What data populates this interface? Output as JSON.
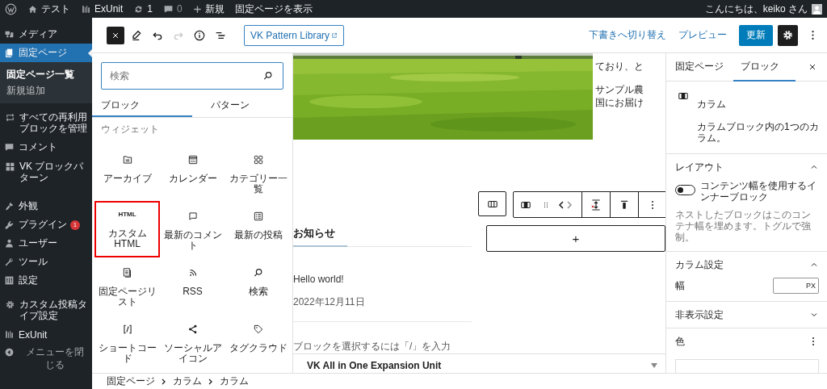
{
  "admin_bar": {
    "items": [
      {
        "kind": "wp"
      },
      {
        "kind": "site",
        "label": "テスト"
      },
      {
        "kind": "exunit",
        "label": "ExUnit"
      },
      {
        "kind": "updates",
        "label": "1"
      },
      {
        "kind": "comments",
        "label": "0"
      },
      {
        "kind": "new",
        "label": "新規"
      },
      {
        "kind": "view",
        "label": "固定ページを表示"
      }
    ],
    "greeting": "こんにちは、keiko さん"
  },
  "sidebar": {
    "sections": [
      {
        "items": [
          {
            "kind": "media",
            "label": "メディア",
            "selected": false
          },
          {
            "kind": "pages",
            "label": "固定ページ",
            "selected": true,
            "children": [
              {
                "label": "固定ページ一覧",
                "selected": true
              },
              {
                "label": "新規追加",
                "selected": false
              }
            ]
          }
        ]
      },
      {
        "items": [
          {
            "kind": "reuse",
            "label": "すべての再利用ブロックを管理",
            "selected": false
          },
          {
            "kind": "comments",
            "label": "コメント",
            "selected": false
          },
          {
            "kind": "grid",
            "label": "VK ブロックパターン",
            "selected": false
          }
        ]
      },
      {
        "items": [
          {
            "kind": "appearance",
            "label": "外観",
            "selected": false
          },
          {
            "kind": "plugins",
            "label": "プラグイン",
            "badge": "1",
            "selected": false
          },
          {
            "kind": "users",
            "label": "ユーザー",
            "selected": false
          },
          {
            "kind": "tools",
            "label": "ツール",
            "selected": false
          },
          {
            "kind": "settings",
            "label": "設定",
            "selected": false
          }
        ]
      },
      {
        "items": [
          {
            "kind": "gear",
            "label": "カスタム投稿タイプ設定",
            "selected": false
          },
          {
            "kind": "exunit",
            "label": "ExUnit",
            "selected": false
          }
        ]
      }
    ],
    "collapse": "メニューを閉じる"
  },
  "toolbar": {
    "tools": [
      {
        "kind": "close",
        "pressed": true,
        "disabled": false
      },
      {
        "kind": "edit",
        "pressed": false,
        "disabled": false
      },
      {
        "kind": "undo",
        "pressed": false,
        "disabled": false
      },
      {
        "kind": "redo",
        "pressed": false,
        "disabled": true
      },
      {
        "kind": "info",
        "pressed": false,
        "disabled": false
      },
      {
        "kind": "list",
        "pressed": false,
        "disabled": false
      }
    ],
    "pattern_button": "VK Pattern Library",
    "draft": "下書きへ切り替え",
    "preview": "プレビュー",
    "update": "更新",
    "settings_pressed": true
  },
  "inserter": {
    "search": {
      "placeholder": "検索"
    },
    "tabs": [
      {
        "label": "ブロック",
        "selected": true
      },
      {
        "label": "パターン",
        "selected": false
      }
    ],
    "category": "ウィジェット",
    "blocks": [
      {
        "kind": "archive",
        "label": "アーカイブ",
        "highlighted": false
      },
      {
        "kind": "calendar",
        "label": "カレンダー",
        "highlighted": false
      },
      {
        "kind": "categories",
        "label": "カテゴリー一覧",
        "highlighted": false
      },
      {
        "kind": "html",
        "icon_text": "HTML",
        "label": "カスタム HTML",
        "highlighted": true
      },
      {
        "kind": "comments",
        "label": "最新のコメント",
        "highlighted": false
      },
      {
        "kind": "posts",
        "label": "最新の投稿",
        "highlighted": false
      },
      {
        "kind": "pages",
        "label": "固定ページリスト",
        "highlighted": false
      },
      {
        "kind": "rss",
        "label": "RSS",
        "highlighted": false
      },
      {
        "kind": "search",
        "label": "検索",
        "highlighted": false
      },
      {
        "kind": "shortcode",
        "label": "ショートコード",
        "highlighted": false
      },
      {
        "kind": "social",
        "label": "ソーシャルアイコン",
        "highlighted": false
      },
      {
        "kind": "tags",
        "label": "タグクラウド",
        "highlighted": false
      }
    ]
  },
  "canvas": {
    "side_paragraphs": [
      [
        "ており、と"
      ],
      [
        "サンプル農",
        "国にお届け"
      ]
    ],
    "heading": "お知らせ",
    "post_title": "Hello world!",
    "post_date": "2022年12月11日",
    "placeholder": "ブロックを選択するには「/」を入力",
    "appender": "+",
    "meta_box": {
      "title": "VK All in One Expansion Unit",
      "expanded": false
    }
  },
  "settings": {
    "tabs": [
      {
        "label": "固定ページ",
        "selected": false
      },
      {
        "label": "ブロック",
        "selected": true
      }
    ],
    "block": {
      "title": "カラム",
      "description": "カラムブロック内の1つのカラム。"
    },
    "panels": [
      {
        "kind": "layout",
        "title": "レイアウト",
        "expanded": true,
        "toggle": {
          "label": "コンテンツ幅を使用するインナーブロック",
          "on": false
        },
        "help": "ネストしたブロックはこのコンテナ幅を埋めます。トグルで強制。"
      },
      {
        "kind": "width",
        "title": "カラム設定",
        "expanded": true,
        "field": {
          "label": "幅",
          "unit": "PX"
        }
      },
      {
        "kind": "plain",
        "title": "非表示設定",
        "expanded": false
      },
      {
        "kind": "color",
        "title": "色",
        "expanded": true
      }
    ]
  },
  "breadcrumb": [
    "固定ページ",
    "カラム",
    "カラム"
  ]
}
